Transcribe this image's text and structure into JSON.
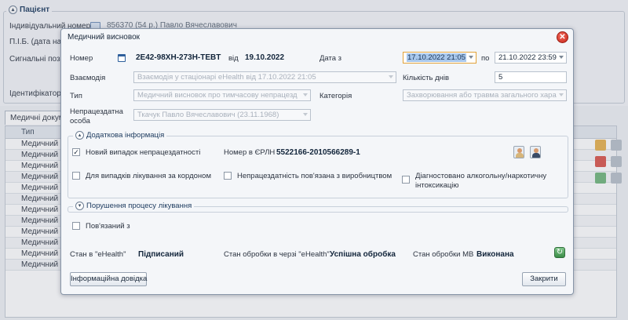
{
  "background": {
    "patient_group": "Пацієнт",
    "labels": {
      "individual_number": "Індивідуальний номер",
      "pib": "П.І.Б. (дата наро",
      "signal": "Сигнальні позн",
      "identifier": "Ідентифікатор п"
    },
    "patient_value": "856370 (54 р.) Павло Вячеславович",
    "tab": "Медичні докум",
    "grid_header": "Тип",
    "row_text": "Медичний с"
  },
  "dialog": {
    "title": "Медичний висновок",
    "number_label": "Номер",
    "number_value": "2E42-98XH-273H-TEBT",
    "from_label": "від",
    "from_date": "19.10.2022",
    "date_from_label": "Дата з",
    "date_from_value": "17.10.2022 21:05",
    "to_label": "по",
    "date_to_value": "21.10.2022 23:59",
    "interaction_label": "Взаємодія",
    "interaction_value": "Взаємодія у стаціонарі eHealth від 17.10.2022 21:05",
    "days_label": "Кількість днів",
    "days_value": "5",
    "type_label": "Тип",
    "type_value": "Медичний висновок про тимчасову непрацезд",
    "category_label": "Категорія",
    "category_value": "Захворювання або травма загального хара",
    "disabled_person_label_1": "Непрацездатна",
    "disabled_person_label_2": "особа",
    "disabled_person_value": "Ткачук Павло Вячеславович (23.11.1968)",
    "additional_group": "Додаткова інформація",
    "new_case_label": "Новий випадок непрацездатності",
    "new_case_checked": true,
    "erln_label": "Номер в ЄРЛН",
    "erln_value": "5522166-2010566289-1",
    "abroad_label": "Для випадків лікування за кордоном",
    "production_label": "Непрацездатність пов'язана з виробництвом",
    "alcohol_label_1": "Діагностовано алкогольну/наркотичну",
    "alcohol_label_2": "інтоксикацію",
    "violations_group": "Порушення процесу лікування",
    "related_label": "Пов'язаний з",
    "ehealth_state_label": "Стан в \"eHealth\"",
    "ehealth_state_value": "Підписаний",
    "queue_state_label": "Стан обробки в черзі \"eHealth\"",
    "queue_state_value": "Успішна обробка",
    "mv_state_label": "Стан обробки МВ",
    "mv_state_value": "Виконана",
    "info_button": "Інформаційна довідка",
    "close_button": "Закрити"
  },
  "colors": {
    "accent": "#2e5f9b",
    "close_red": "#c8261a",
    "refresh_green": "#3b8d48"
  }
}
